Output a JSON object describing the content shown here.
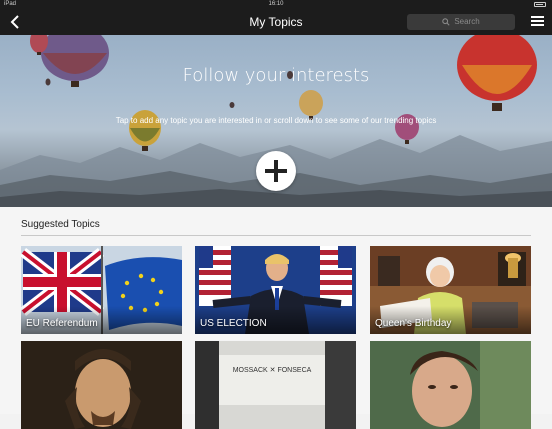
{
  "status_bar": {
    "carrier": "iPad",
    "time": "16:10"
  },
  "nav": {
    "title": "My Topics",
    "search_placeholder": "Search"
  },
  "hero": {
    "title": "Follow your interests",
    "subtitle": "Tap to add any topic you are interested in or scroll down to see some of our trending topics"
  },
  "suggested": {
    "heading": "Suggested Topics",
    "topics": [
      {
        "label": "EU Referendum"
      },
      {
        "label": "US ELECTION"
      },
      {
        "label": "Queen's Birthday"
      },
      {
        "label": ""
      },
      {
        "label": ""
      },
      {
        "label": ""
      }
    ]
  },
  "colors": {
    "nav_background": "#1c1c1c",
    "hero_sky": "#a9bdd0",
    "page_background": "#f5f5f5"
  }
}
